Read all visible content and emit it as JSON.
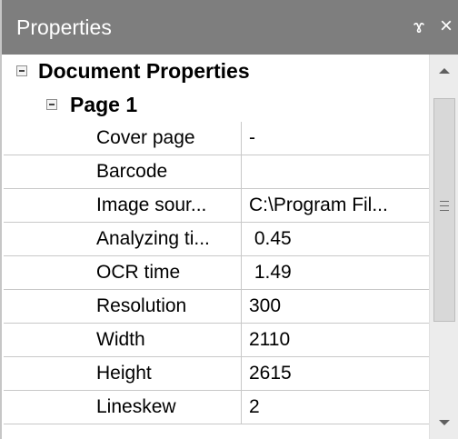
{
  "panel": {
    "title": "Properties",
    "pin_glyph": "ɤ",
    "close_glyph": "×",
    "pin_icon": "pin-icon",
    "close_icon": "close-icon"
  },
  "grid": {
    "category": "Document Properties",
    "subcategory": "Page 1",
    "rows": [
      {
        "name": "Cover page",
        "value": "-"
      },
      {
        "name": "Barcode",
        "value": ""
      },
      {
        "name": "Image sour...",
        "value": "C:\\Program Fil..."
      },
      {
        "name": "Analyzing ti...",
        "value": " 0.45"
      },
      {
        "name": "OCR time",
        "value": " 1.49"
      },
      {
        "name": "Resolution",
        "value": "300"
      },
      {
        "name": "Width",
        "value": "2110"
      },
      {
        "name": "Height",
        "value": "2615"
      },
      {
        "name": "Lineskew",
        "value": "2"
      }
    ]
  },
  "colors": {
    "titlebar": "#7e7e7e",
    "gridline": "#c8c8c8",
    "scrollbar_track": "#ececec",
    "scrollbar_thumb": "#d8d8d8"
  },
  "scrollbar": {
    "position_fraction": 0.0,
    "visible_fraction": 0.75
  }
}
